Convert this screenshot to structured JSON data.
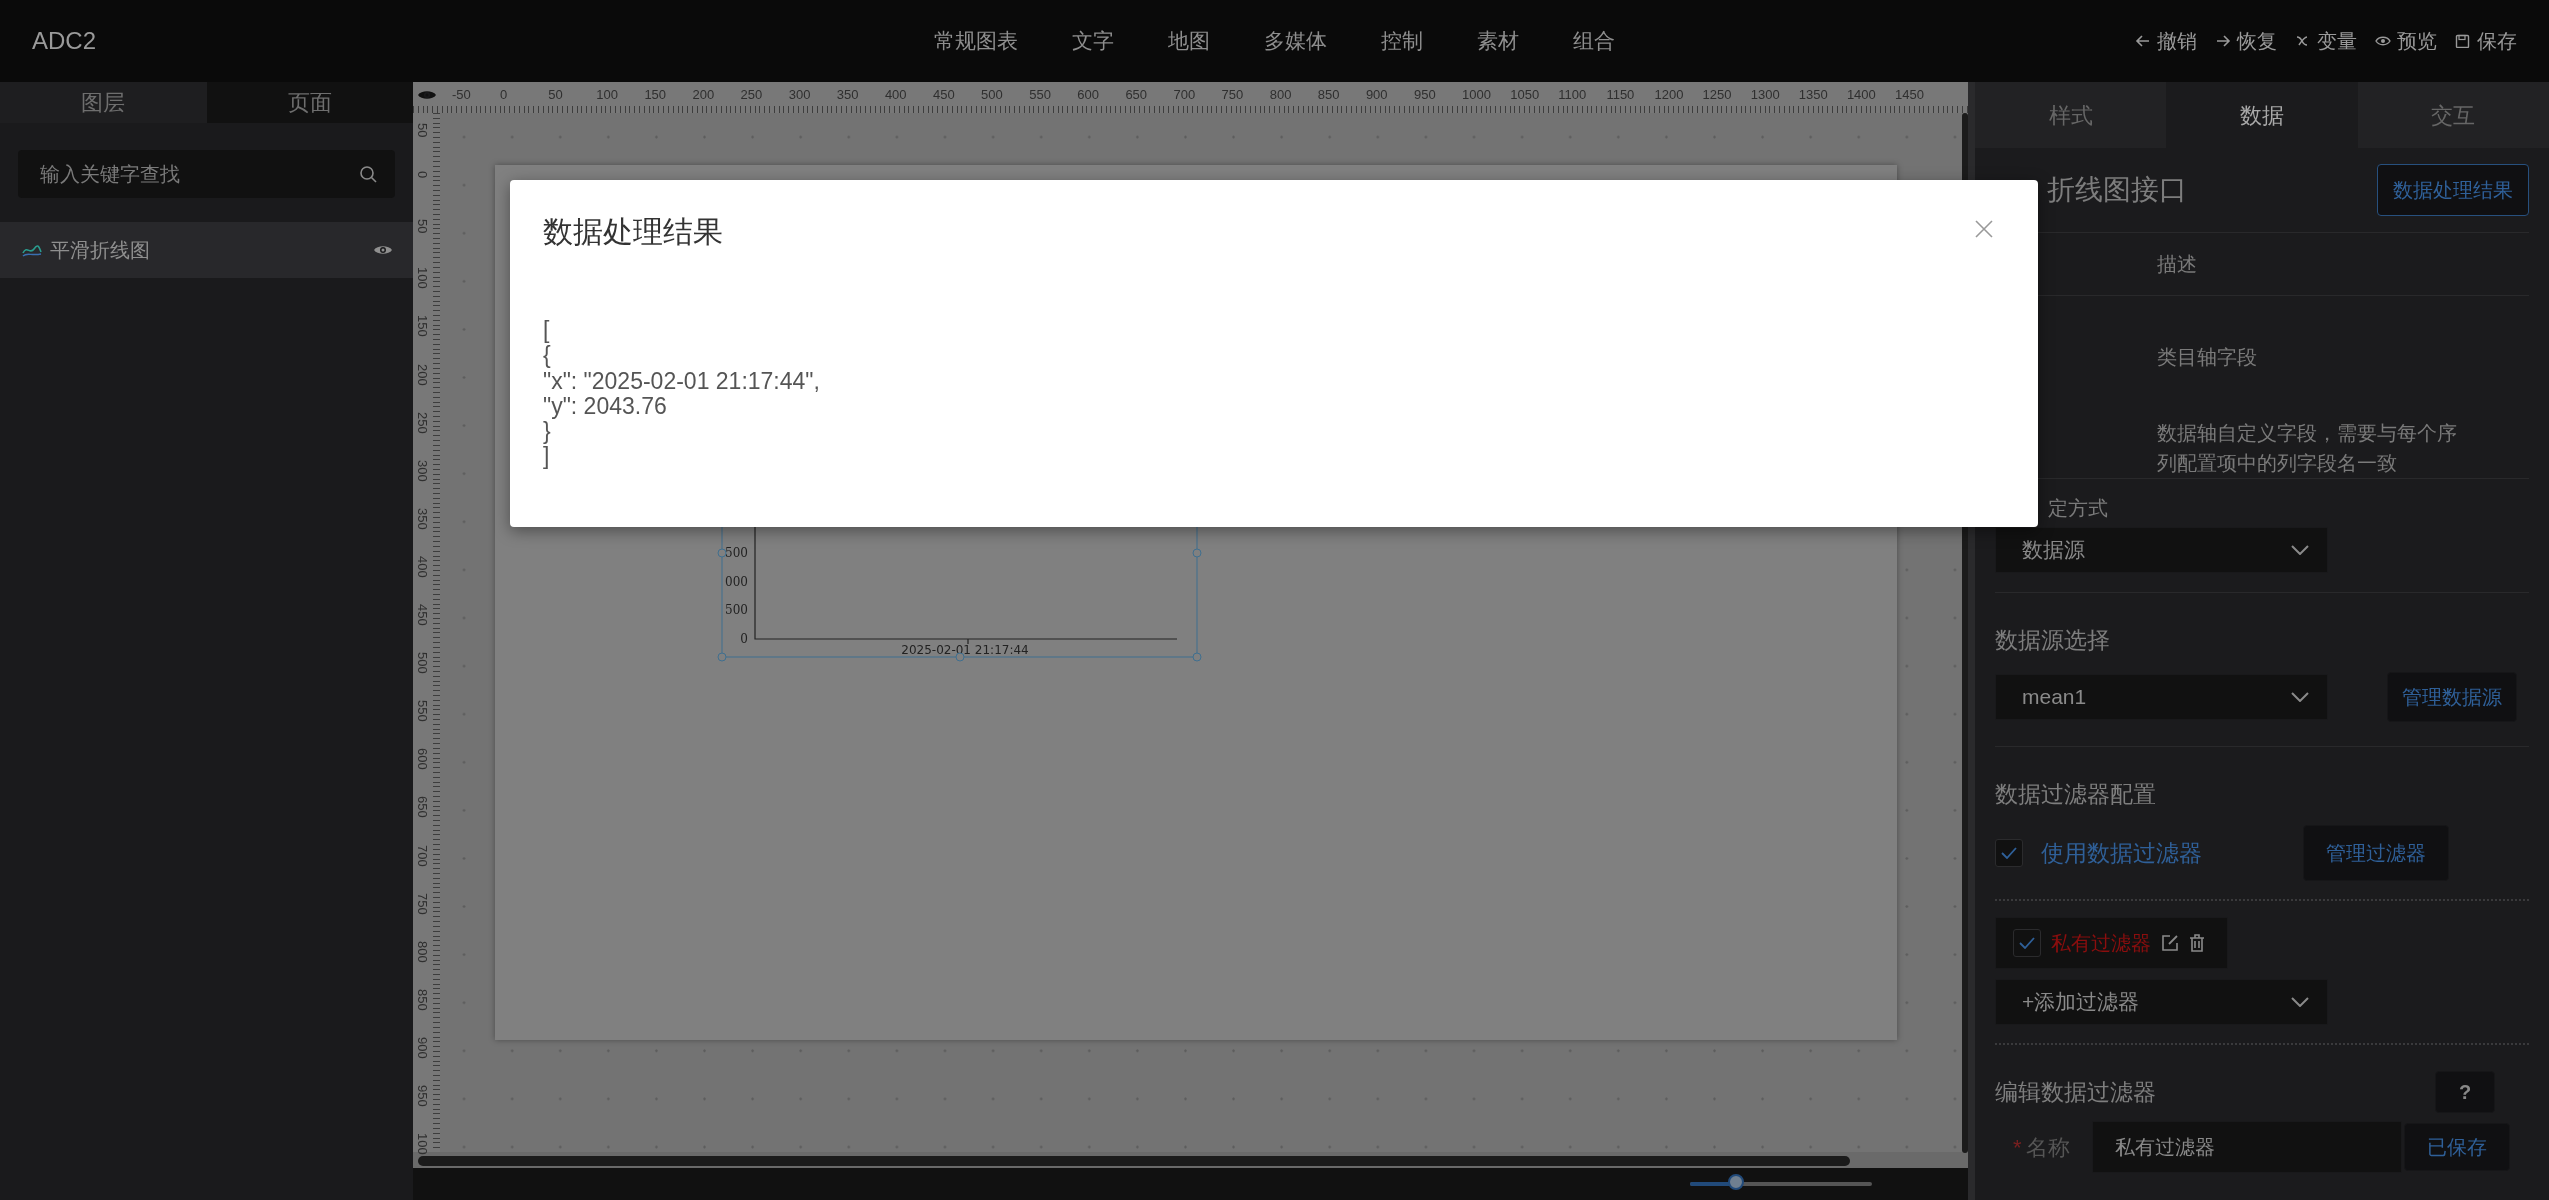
{
  "app": {
    "title": "ADC2"
  },
  "menu": [
    {
      "label": "常规图表"
    },
    {
      "label": "文字"
    },
    {
      "label": "地图"
    },
    {
      "label": "多媒体"
    },
    {
      "label": "控制"
    },
    {
      "label": "素材"
    },
    {
      "label": "组合"
    }
  ],
  "toolbar": [
    {
      "kind": "undo",
      "label": "撤销"
    },
    {
      "kind": "redo",
      "label": "恢复"
    },
    {
      "kind": "variable",
      "label": "变量"
    },
    {
      "kind": "preview",
      "label": "预览"
    },
    {
      "kind": "save",
      "label": "保存"
    }
  ],
  "left_panel": {
    "tabs": [
      {
        "label": "图层",
        "selected": true
      },
      {
        "label": "页面",
        "selected": false
      }
    ],
    "search": {
      "placeholder": "输入关键字查找"
    },
    "layers": [
      {
        "label": "平滑折线图",
        "selected": true
      }
    ]
  },
  "canvas": {
    "top_ruler": [
      "-50",
      "0",
      "50",
      "100",
      "150",
      "200",
      "250",
      "300",
      "350",
      "400",
      "450",
      "500",
      "550",
      "600",
      "650",
      "700",
      "750",
      "800",
      "850",
      "900",
      "950",
      "1000",
      "1050",
      "1100",
      "1150",
      "1200",
      "1250",
      "1300",
      "1350",
      "1400",
      "1450"
    ],
    "left_ruler": [
      "50",
      "0",
      "50",
      "100",
      "150",
      "200",
      "250",
      "300",
      "350",
      "400",
      "450",
      "500",
      "550",
      "600",
      "650",
      "700",
      "750",
      "800",
      "850",
      "900",
      "950",
      "100"
    ],
    "chart": {
      "y_tick_labels": [
        "500",
        "000",
        "500",
        "0"
      ],
      "x_tick_label": "2025-02-01 21:17:44"
    },
    "zoom": {
      "level": 0.25
    }
  },
  "right_panel": {
    "tabs": [
      {
        "label": "样式",
        "selected": false
      },
      {
        "label": "数据",
        "selected": true
      },
      {
        "label": "交互",
        "selected": false
      }
    ],
    "title": "折线图接口",
    "result_button": "数据处理结果",
    "table": {
      "columns": [
        "描述"
      ],
      "rows": [
        {
          "description": "类目轴字段"
        },
        {
          "description": "数据轴自定义字段，需要与每个序列配置项中的列字段名一致"
        }
      ]
    },
    "binding": {
      "label": "定方式",
      "value": "数据源"
    },
    "source": {
      "heading": "数据源选择",
      "value": "mean1",
      "button": "管理数据源"
    },
    "filter": {
      "heading": "数据过滤器配置",
      "use": {
        "label": "使用数据过滤器",
        "checked": true
      },
      "button": "管理过滤器",
      "items": [
        {
          "label": "私有过滤器",
          "checked": true
        }
      ],
      "add": "+添加过滤器"
    },
    "editor": {
      "heading": "编辑数据过滤器",
      "help": "?",
      "required_mark": "*",
      "name_label": "名称",
      "name_value": "私有过滤器",
      "save_button": "已保存"
    }
  },
  "modal": {
    "title": "数据处理结果",
    "lines": [
      "[",
      "{",
      "\"x\": \"2025-02-01 21:17:44\",",
      "\"y\": 2043.76",
      "}",
      "]"
    ]
  }
}
